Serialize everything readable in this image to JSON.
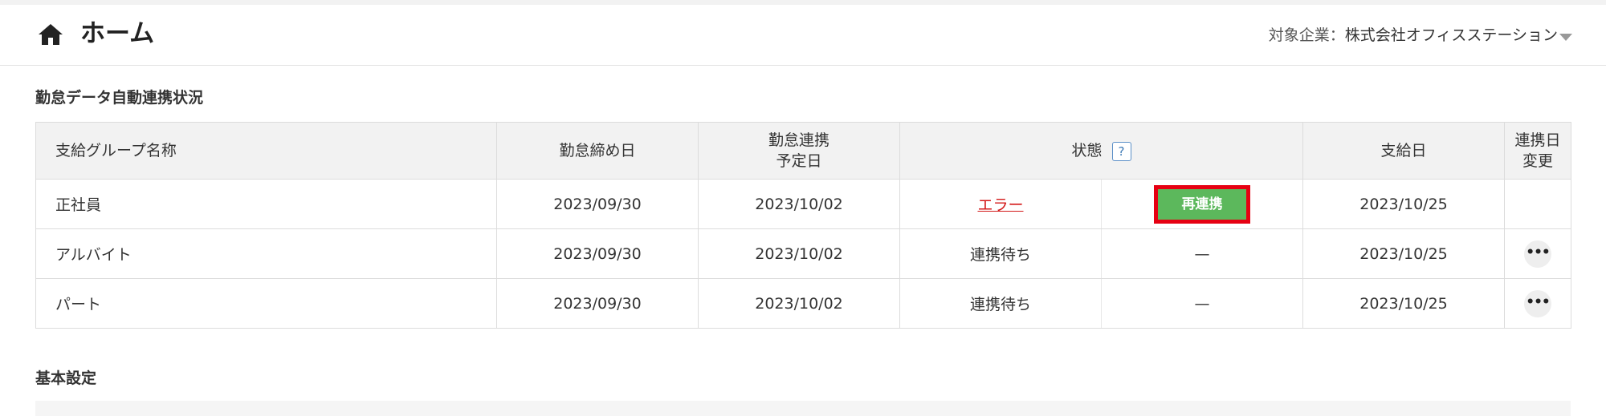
{
  "header": {
    "title": "ホーム",
    "company_label": "対象企業：",
    "company_name": "株式会社オフィスステーション",
    "icons": {
      "home": "home-icon",
      "dropdown": "caret-down-icon"
    }
  },
  "attendance_section": {
    "title": "勤怠データ自動連携状況",
    "columns": {
      "group": "支給グループ名称",
      "closing_date": "勤怠締め日",
      "sync_date_line1": "勤怠連携",
      "sync_date_line2": "予定日",
      "status": "状態",
      "status_help": "?",
      "pay_date": "支給日",
      "change_line1": "連携日",
      "change_line2": "変更"
    },
    "rows": [
      {
        "group": "正社員",
        "closing_date": "2023/09/30",
        "sync_date": "2023/10/02",
        "status": "エラー",
        "action": "再連携",
        "pay_date": "2023/10/25",
        "menu": ""
      },
      {
        "group": "アルバイト",
        "closing_date": "2023/09/30",
        "sync_date": "2023/10/02",
        "status": "連携待ち",
        "action": "—",
        "pay_date": "2023/10/25",
        "menu": "•••"
      },
      {
        "group": "パート",
        "closing_date": "2023/09/30",
        "sync_date": "2023/10/02",
        "status": "連携待ち",
        "action": "—",
        "pay_date": "2023/10/25",
        "menu": "•••"
      }
    ],
    "colors": {
      "error": "#d31818",
      "relink_button": "#5cb85c",
      "highlight_frame": "#e60012"
    }
  },
  "basic_settings": {
    "title": "基本設定"
  }
}
